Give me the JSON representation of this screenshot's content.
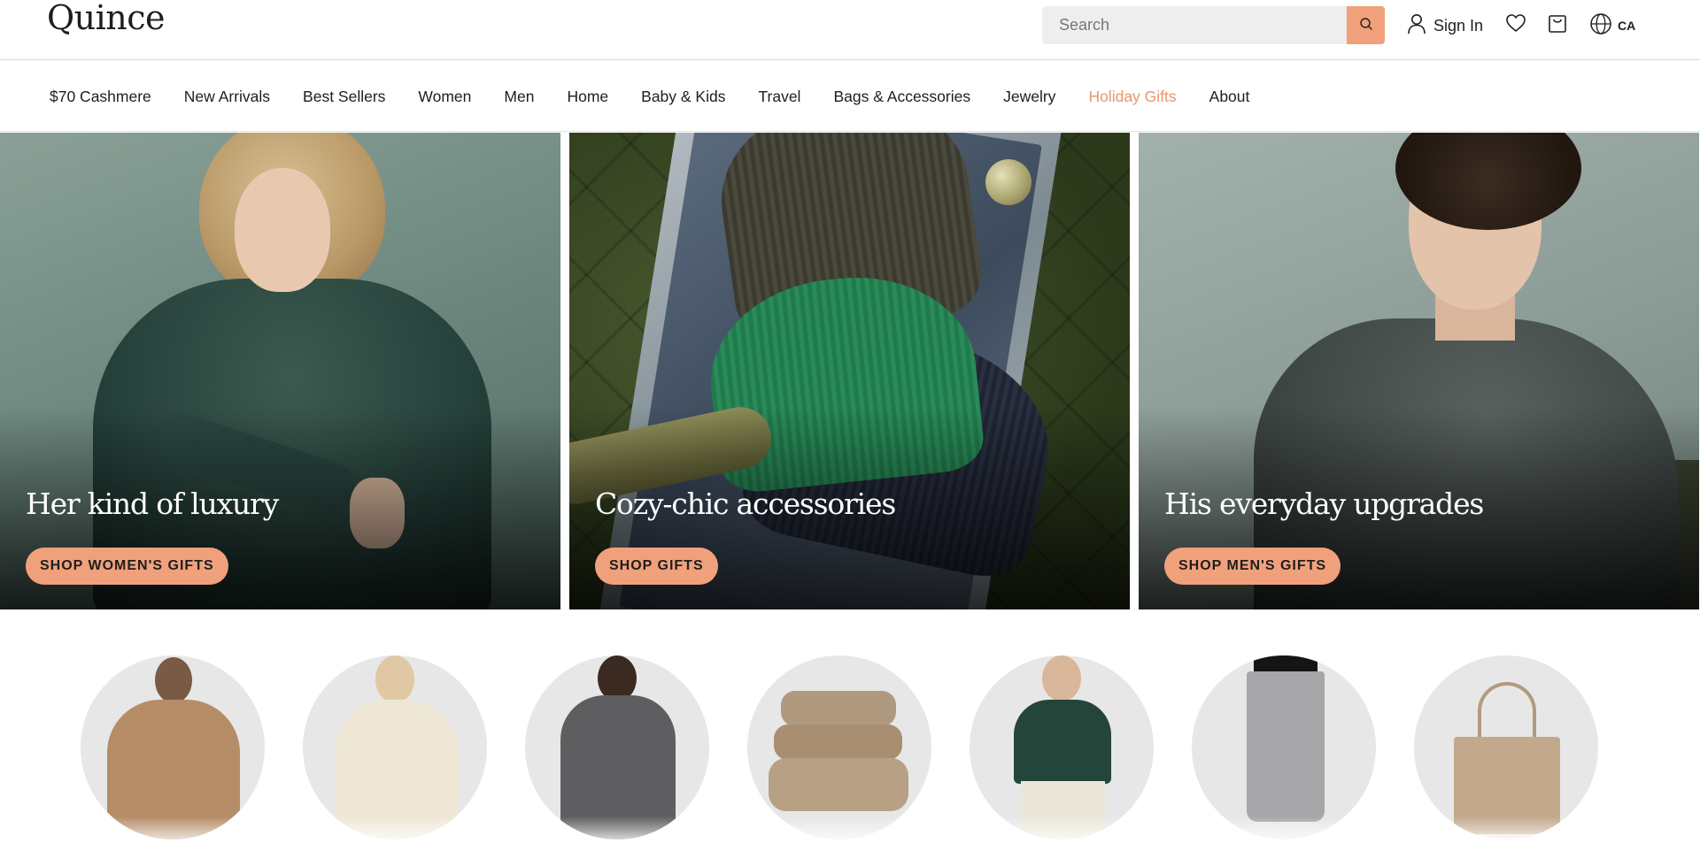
{
  "header": {
    "logo": "Quince",
    "search": {
      "placeholder": "Search"
    },
    "sign_in_label": "Sign In",
    "region_label": "CA",
    "icons": [
      "search-icon",
      "user-icon",
      "heart-icon",
      "cart-icon",
      "globe-icon"
    ]
  },
  "nav": {
    "items": [
      {
        "label": "$70 Cashmere"
      },
      {
        "label": "New Arrivals"
      },
      {
        "label": "Best Sellers"
      },
      {
        "label": "Women"
      },
      {
        "label": "Men"
      },
      {
        "label": "Home"
      },
      {
        "label": "Baby & Kids"
      },
      {
        "label": "Travel"
      },
      {
        "label": "Bags & Accessories"
      },
      {
        "label": "Jewelry"
      },
      {
        "label": "Holiday Gifts"
      },
      {
        "label": "About"
      }
    ]
  },
  "hero": {
    "panels": [
      {
        "title": "Her kind of luxury",
        "button": "SHOP WOMEN'S GIFTS"
      },
      {
        "title": "Cozy-chic accessories",
        "button": "SHOP GIFTS"
      },
      {
        "title": "His everyday upgrades",
        "button": "SHOP MEN'S GIFTS"
      }
    ]
  },
  "colors": {
    "accent": "#f0a17c",
    "accent_text": "#e8956d",
    "text": "#1e1e1e",
    "search_bg": "#eeeeee",
    "circle_bg": "#e7e7e7"
  }
}
